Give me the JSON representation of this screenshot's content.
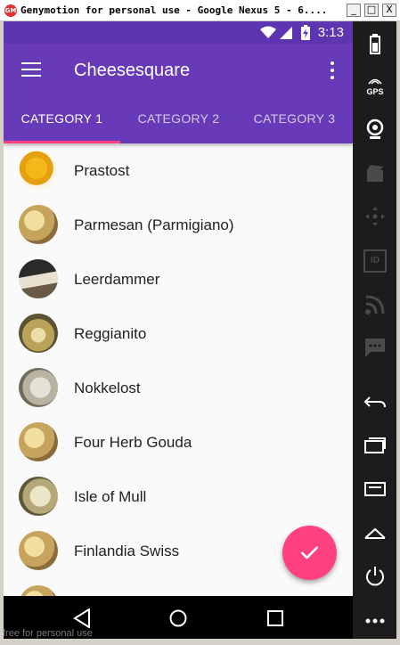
{
  "window": {
    "title": "Genymotion for personal use - Google Nexus 5 - 6....",
    "buttons": [
      "_",
      "□",
      "X"
    ]
  },
  "status_bar": {
    "time": "3:13"
  },
  "app_bar": {
    "title": "Cheesesquare",
    "tabs": [
      {
        "label": "CATEGORY 1",
        "active": true
      },
      {
        "label": "CATEGORY 2",
        "active": false
      },
      {
        "label": "CATEGORY 3",
        "active": false
      }
    ]
  },
  "list": {
    "items": [
      {
        "label": "Prastost"
      },
      {
        "label": "Parmesan (Parmigiano)"
      },
      {
        "label": "Leerdammer"
      },
      {
        "label": "Reggianito"
      },
      {
        "label": "Nokkelost"
      },
      {
        "label": "Four Herb Gouda"
      },
      {
        "label": "Isle of Mull"
      },
      {
        "label": "Finlandia Swiss"
      }
    ]
  },
  "fab": {
    "icon": "check-icon"
  },
  "side_panel": {
    "gps_label": "GPS",
    "id_label": "ID"
  },
  "watermark": "free for personal use",
  "colors": {
    "primary": "#673ab7",
    "primary_dark": "#5e35b1",
    "accent": "#ff4081"
  }
}
